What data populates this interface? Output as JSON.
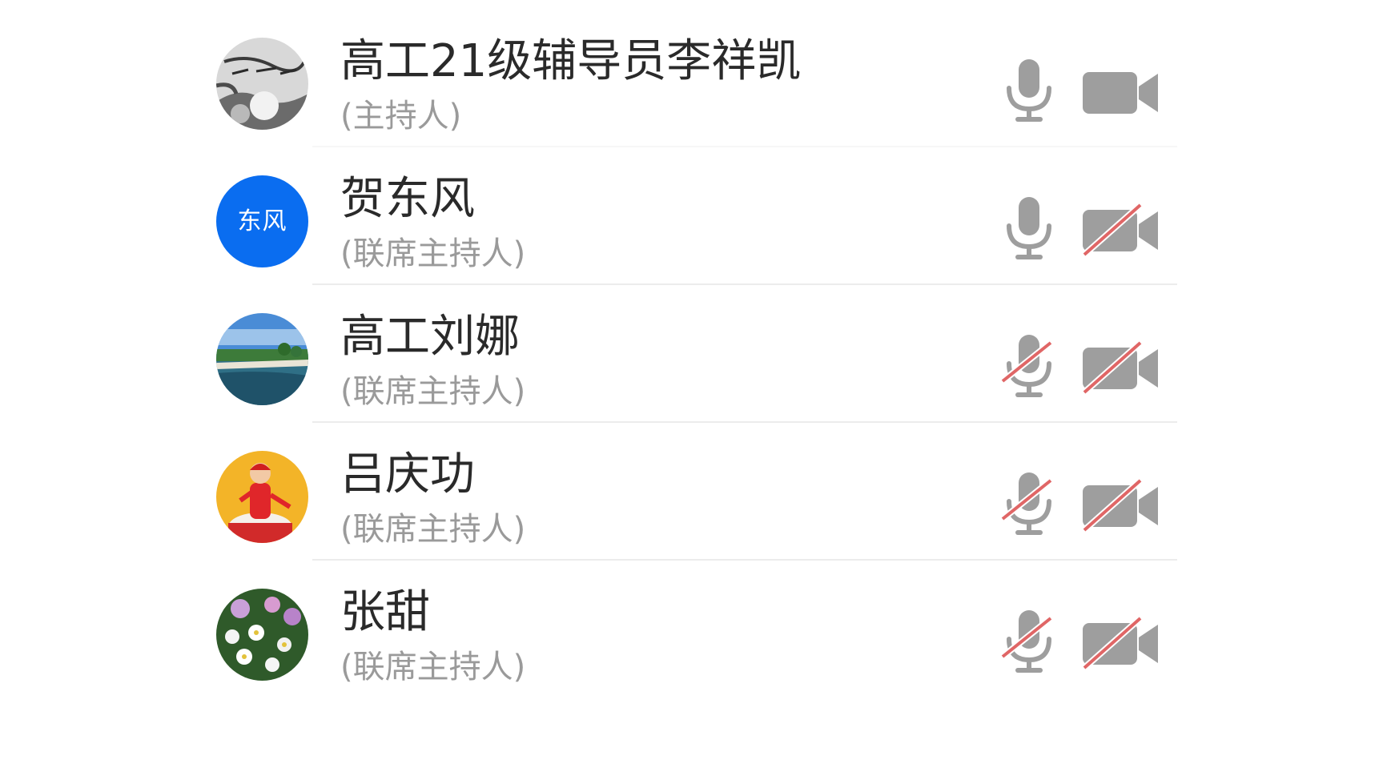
{
  "colors": {
    "icon_gray": "#9e9e9e",
    "muted_red": "#e06666",
    "avatar_blue": "#0a6df0",
    "name_text": "#2a2a2a",
    "role_text": "#9a9a9a"
  },
  "participants": [
    {
      "name": "高工21级辅导员李祥凯",
      "role": "(主持人)",
      "avatar": "photo-calligraphy",
      "mic": "mic-icon",
      "camera": "camera-icon"
    },
    {
      "name": "贺东风",
      "role": "(联席主持人)",
      "avatar_text": "东风",
      "mic": "mic-icon",
      "camera": "camera-off-icon"
    },
    {
      "name": "高工刘娜",
      "role": "(联席主持人)",
      "avatar": "photo-seaside-pier",
      "mic": "mic-off-icon",
      "camera": "camera-off-icon"
    },
    {
      "name": "吕庆功",
      "role": "(联席主持人)",
      "avatar": "photo-child-red-drum",
      "mic": "mic-off-icon",
      "camera": "camera-off-icon"
    },
    {
      "name": "张甜",
      "role": "(联席主持人)",
      "avatar": "photo-flowers",
      "mic": "mic-off-icon",
      "camera": "camera-off-icon"
    }
  ]
}
